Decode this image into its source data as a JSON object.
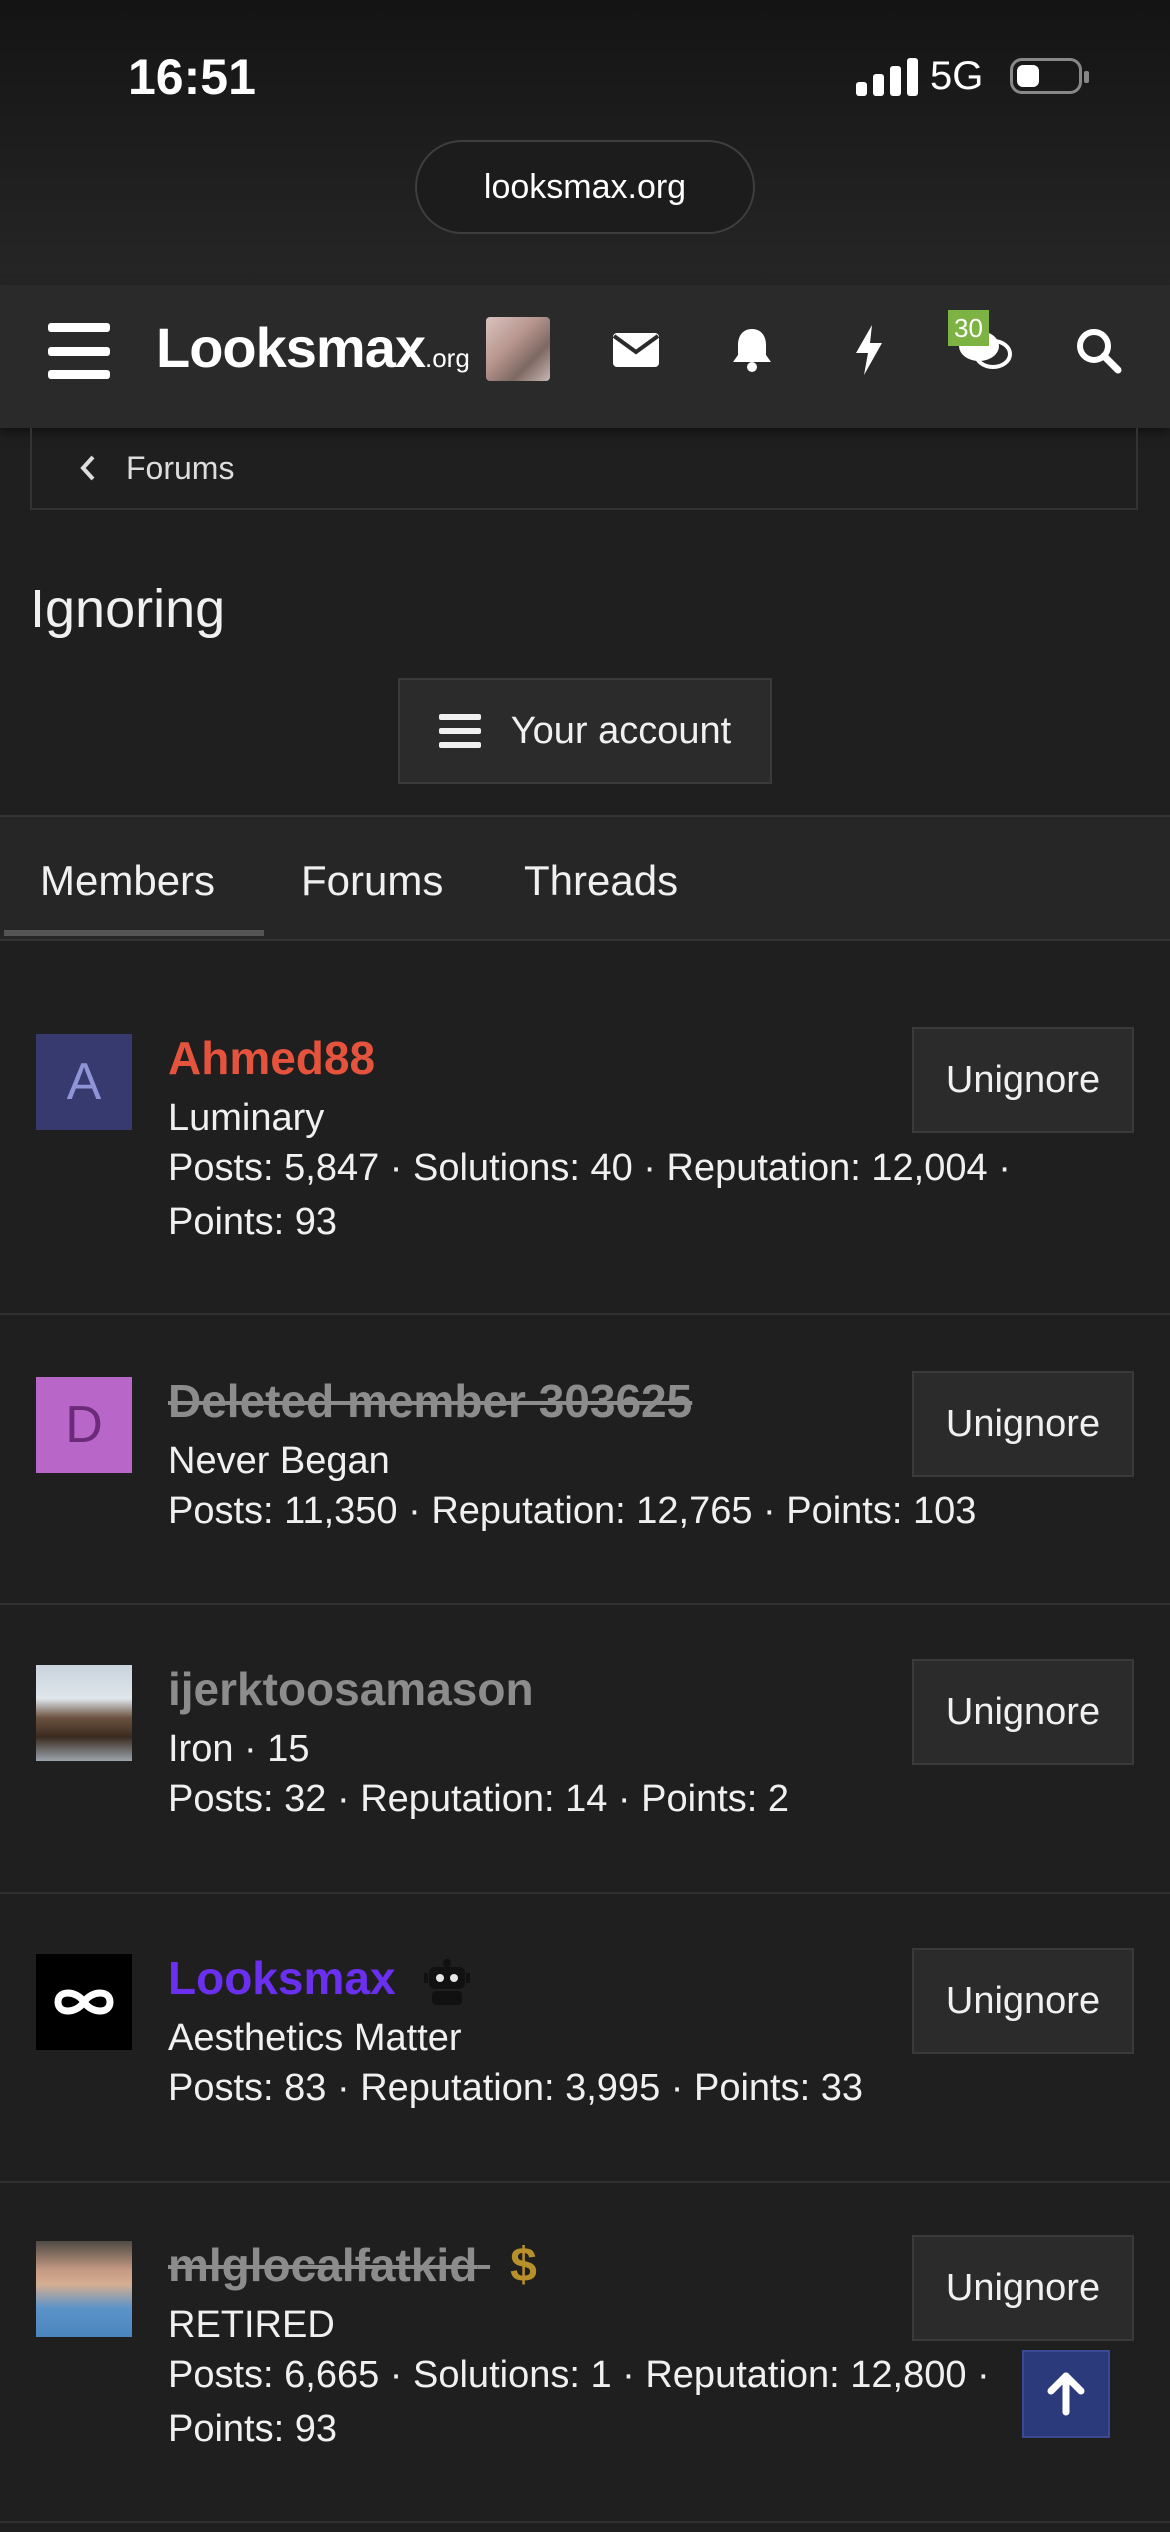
{
  "status_bar": {
    "time": "16:51",
    "network": "5G"
  },
  "browser": {
    "url": "looksmax.org"
  },
  "nav": {
    "logo_main": "Looksmax",
    "logo_suffix": ".org",
    "conversations_badge": "30",
    "icons": [
      "menu-icon",
      "avatar",
      "mail-icon",
      "bell-icon",
      "bolt-icon",
      "chat-icon",
      "search-icon"
    ]
  },
  "breadcrumb": {
    "label": "Forums"
  },
  "page": {
    "title": "Ignoring",
    "account_button": "Your account"
  },
  "tabs": [
    "Members",
    "Forums",
    "Threads"
  ],
  "members": [
    {
      "initial": "A",
      "name": "Ahmed88",
      "name_color": "#e5533d",
      "title": "Luminary",
      "stats_line1": "Posts: 5,847 · Solutions: 40 · Reputation: 12,004 ·",
      "stats_line2": "Points: 93",
      "button": "Unignore"
    },
    {
      "initial": "D",
      "name": "Deleted member 303625",
      "name_color": "#8c8c8c",
      "title": "Never Began",
      "stats_line1": "Posts: 11,350 · Reputation: 12,765 · Points: 103",
      "stats_line2": "",
      "button": "Unignore"
    },
    {
      "initial": "",
      "name": "ijerktoosamason",
      "name_color": "#8c8c8c",
      "title": "Iron · 15",
      "stats_line1": "Posts: 32 · Reputation: 14 · Points: 2",
      "stats_line2": "",
      "button": "Unignore"
    },
    {
      "initial": "",
      "name": "Looksmax",
      "name_color": "#6b2ff0",
      "title": "Aesthetics Matter",
      "stats_line1": "Posts: 83 · Reputation: 3,995 · Points: 33",
      "stats_line2": "",
      "button": "Unignore"
    },
    {
      "initial": "",
      "name": "mlglocalfatkid",
      "name_color": "#8c8c8c",
      "title": "RETIRED",
      "stats_line1": "Posts: 6,665 · Solutions: 1 · Reputation: 12,800 ·",
      "stats_line2": "Points: 93",
      "button": "Unignore"
    }
  ]
}
